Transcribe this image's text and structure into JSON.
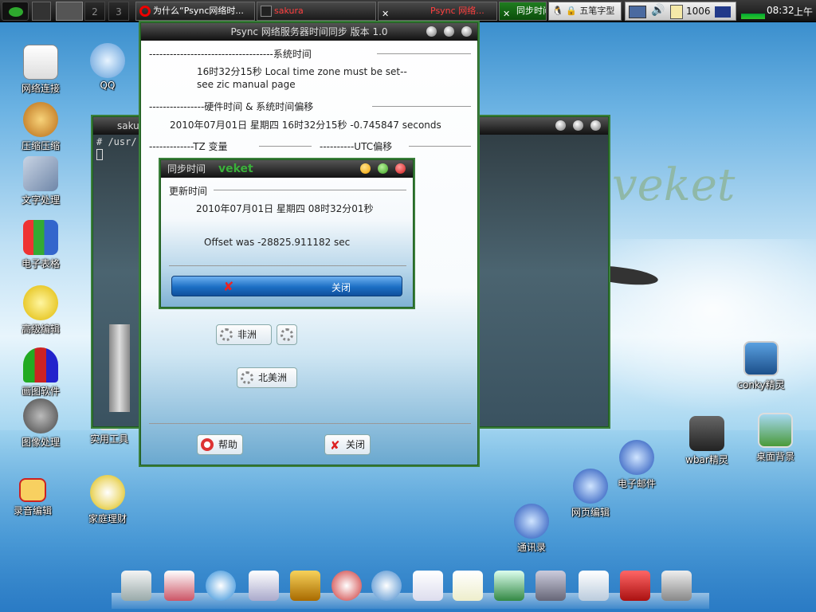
{
  "taskbar": {
    "workspaces": [
      "2",
      "3"
    ],
    "tasks": [
      {
        "label": "为什么“Psync网络时..."
      },
      {
        "label": "sakura"
      },
      {
        "label": "Psync 网络..."
      },
      {
        "label": "同步时间"
      }
    ],
    "ime": "五笔字型",
    "clock_count": "1006",
    "time": "08:32",
    "ampm": "上午"
  },
  "desktop": {
    "icons_left": [
      {
        "label": "网络连接"
      },
      {
        "label": "压缩压缩"
      },
      {
        "label": "文字处理"
      },
      {
        "label": "电子表格"
      },
      {
        "label": "高级编辑"
      },
      {
        "label": "画图软件"
      },
      {
        "label": "图像处理"
      },
      {
        "label": "录音编辑"
      }
    ],
    "icons_col2": [
      {
        "label": "QQ"
      },
      {
        "label": "实用工具"
      },
      {
        "label": "家庭理财"
      }
    ],
    "icons_right": [
      {
        "label": "conky精灵"
      },
      {
        "label": "wbar精灵"
      },
      {
        "label": "桌面背景"
      },
      {
        "label": "电子邮件"
      },
      {
        "label": "网页编辑"
      },
      {
        "label": "通讯录"
      }
    ],
    "wallpaper_logo": "veket"
  },
  "terminal": {
    "title": "sakura",
    "prompt": "# /usr/"
  },
  "psync": {
    "title": "Psync 网络服务器时间同步 版本 1.0",
    "sys_header": "------------------------------------系统时间",
    "sys_line1": "16时32分15秒    Local time zone must be set--",
    "sys_line2": "see zic manual page",
    "hw_header": "----------------硬件时间 & 系统时间偏移",
    "hw_line": "2010年07月01日  星期四  16时32分15秒   -0.745847 seconds",
    "tz_header": "-------------TZ 变量",
    "utc_header": "----------UTC偏移",
    "btn_africa": "非洲",
    "btn_namerica": "北美洲",
    "btn_help": "帮助",
    "btn_close": "关闭"
  },
  "sync_dialog": {
    "title": "同步时间",
    "brand": "veket",
    "section": "更新时间",
    "datetime": "2010年07月01日  星期四  08时32分01秒",
    "offset": "Offset was  -28825.911182 sec",
    "close_label": "关闭"
  },
  "colors": {
    "accent_green": "#2e8b2e",
    "dialog_button": "#1c6fc4",
    "taskbar": "#1a1a1a"
  }
}
